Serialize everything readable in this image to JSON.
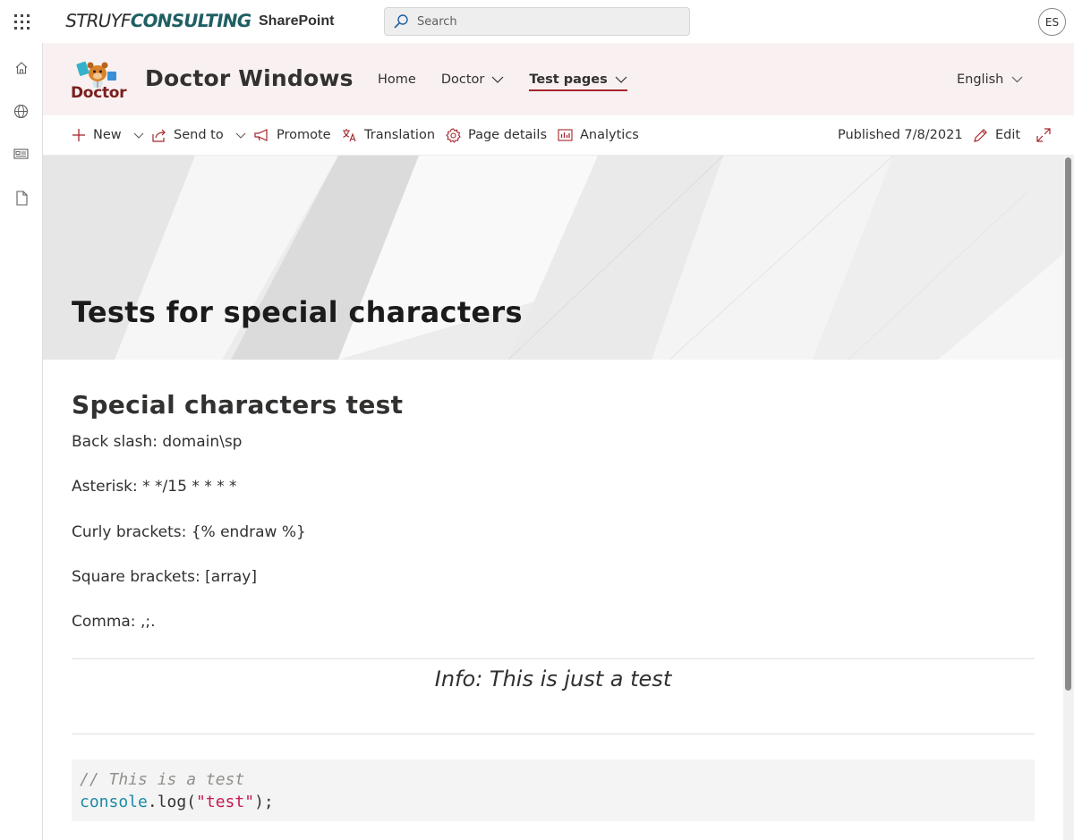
{
  "suitebar": {
    "brand_part1": "STRUYF",
    "brand_part2": "CONSULTING",
    "app_name": "SharePoint",
    "search_placeholder": "Search",
    "avatar_initials": "ES"
  },
  "left_rail": {
    "items": [
      {
        "icon": "home-icon"
      },
      {
        "icon": "globe-icon"
      },
      {
        "icon": "news-icon"
      },
      {
        "icon": "document-icon"
      }
    ]
  },
  "site": {
    "logo_text": "Doctor",
    "title": "Doctor Windows",
    "nav": [
      {
        "label": "Home",
        "has_dropdown": false,
        "active": false
      },
      {
        "label": "Doctor",
        "has_dropdown": true,
        "active": false
      },
      {
        "label": "Test pages",
        "has_dropdown": true,
        "active": true
      }
    ],
    "language": "English",
    "accent_color": "#a4262c"
  },
  "commandbar": {
    "new_label": "New",
    "send_to_label": "Send to",
    "promote_label": "Promote",
    "translation_label": "Translation",
    "page_details_label": "Page details",
    "analytics_label": "Analytics",
    "published_label": "Published 7/8/2021",
    "edit_label": "Edit"
  },
  "page": {
    "hero_title": "Tests for special characters",
    "heading": "Special characters test",
    "lines": [
      "Back slash: domain\\sp",
      "Asterisk: * */15 * * * *",
      "Curly brackets: {% endraw %}",
      "Square brackets: [array]",
      "Comma: ,;."
    ],
    "info_text": "Info: This is just a test",
    "code": {
      "line1_comment": "// This is a test",
      "line2_object": "console",
      "line2_method": ".log(",
      "line2_string": "\"test\"",
      "line2_end": ");"
    }
  }
}
